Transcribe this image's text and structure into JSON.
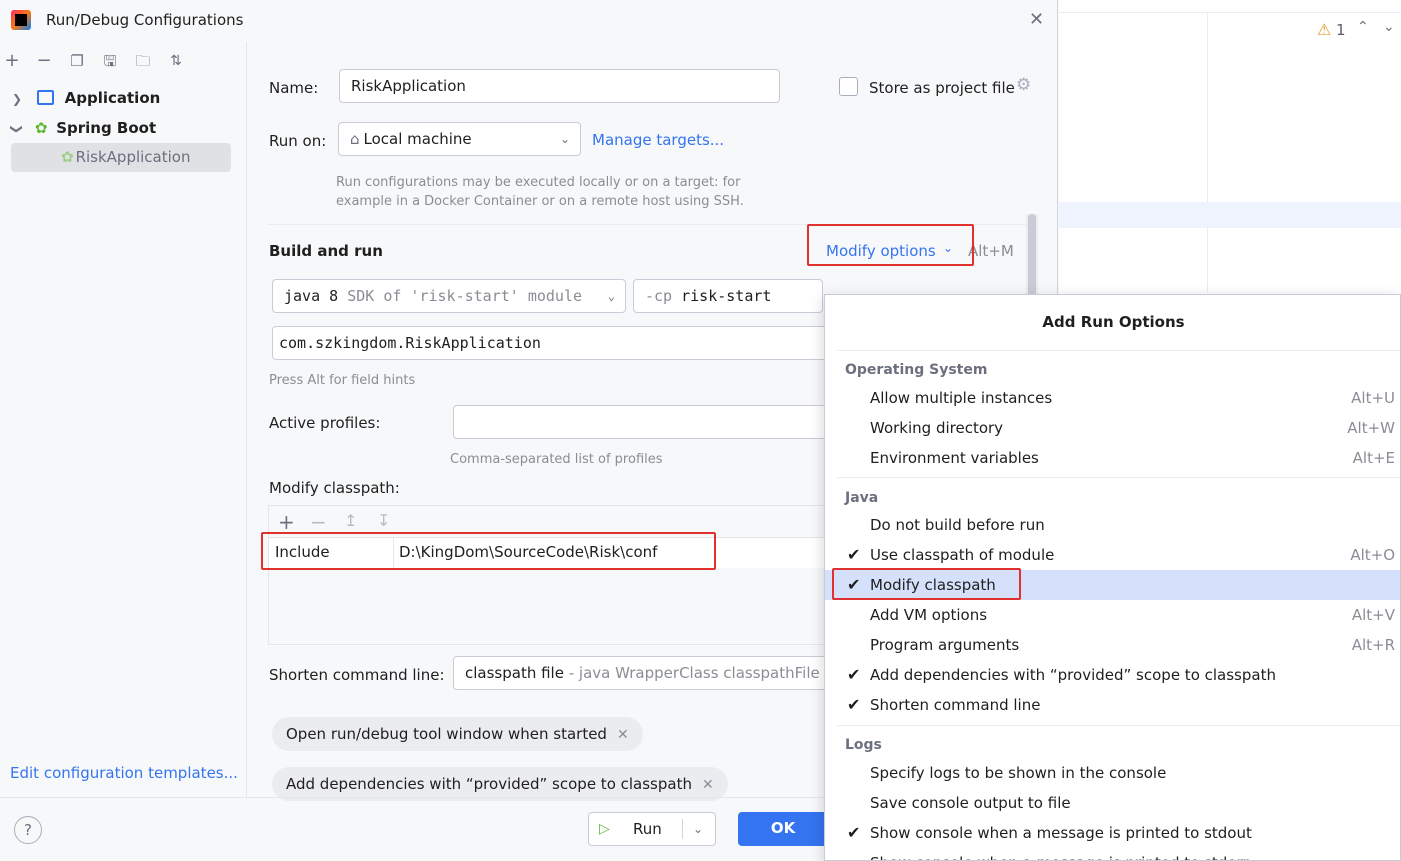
{
  "window": {
    "title": "Run/Debug Configurations"
  },
  "toolbar": {
    "icons": [
      "add-icon",
      "remove-icon",
      "copy-icon",
      "save-icon",
      "new-folder-icon",
      "sort-icon"
    ]
  },
  "tree": {
    "items": [
      {
        "label": "Application",
        "icon": "application-icon",
        "expanded": false
      },
      {
        "label": "Spring Boot",
        "icon": "spring-boot-icon",
        "expanded": true
      },
      {
        "label": "RiskApplication",
        "icon": "spring-boot-icon",
        "selected": true
      }
    ]
  },
  "left_footer": {
    "edit_templates": "Edit configuration templates..."
  },
  "form": {
    "name_label": "Name:",
    "name_value": "RiskApplication",
    "store_label": "Store as project file",
    "run_on_label": "Run on:",
    "run_on_value": "Local machine",
    "manage_targets": "Manage targets...",
    "run_on_hint_1": "Run configurations may be executed locally or on a target: for",
    "run_on_hint_2": "example in a Docker Container or on a remote host using SSH.",
    "build_run_title": "Build and run",
    "modify_options": "Modify options",
    "modify_options_shortcut": "Alt+M",
    "jdk_java": "java 8",
    "jdk_desc": "SDK of 'risk-start' module",
    "cp_flag": "-cp",
    "cp_value": "risk-start",
    "main_class": "com.szkingdom.RiskApplication",
    "field_hint": "Press Alt for field hints",
    "active_profiles_label": "Active profiles:",
    "active_profiles_value": "",
    "profiles_hint": "Comma-separated list of profiles",
    "modify_classpath_label": "Modify classpath:",
    "classpath_rows": [
      {
        "type": "Include",
        "path": "D:\\KingDom\\SourceCode\\Risk\\conf"
      }
    ],
    "shorten_label": "Shorten command line:",
    "shorten_value": "classpath file",
    "shorten_desc": "- java WrapperClass classpathFile cla",
    "chips": [
      "Open run/debug tool window when started",
      "Add dependencies with “provided” scope to classpath"
    ]
  },
  "footer": {
    "run_label": "Run",
    "ok_label": "OK",
    "help_label": "?"
  },
  "editor": {
    "warning_count": "1"
  },
  "popup": {
    "title": "Add Run Options",
    "sections": [
      {
        "name": "Operating System",
        "items": [
          {
            "label": "Allow multiple instances",
            "shortcut": "Alt+U",
            "checked": false
          },
          {
            "label": "Working directory",
            "shortcut": "Alt+W",
            "checked": false
          },
          {
            "label": "Environment variables",
            "shortcut": "Alt+E",
            "checked": false
          }
        ]
      },
      {
        "name": "Java",
        "items": [
          {
            "label": "Do not build before run",
            "shortcut": "",
            "checked": false
          },
          {
            "label": "Use classpath of module",
            "shortcut": "Alt+O",
            "checked": true
          },
          {
            "label": "Modify classpath",
            "shortcut": "",
            "checked": true,
            "highlighted": true
          },
          {
            "label": "Add VM options",
            "shortcut": "Alt+V",
            "checked": false
          },
          {
            "label": "Program arguments",
            "shortcut": "Alt+R",
            "checked": false
          },
          {
            "label": "Add dependencies with “provided” scope to classpath",
            "shortcut": "",
            "checked": true
          },
          {
            "label": "Shorten command line",
            "shortcut": "",
            "checked": true
          }
        ]
      },
      {
        "name": "Logs",
        "items": [
          {
            "label": "Specify logs to be shown in the console",
            "shortcut": "",
            "checked": false
          },
          {
            "label": "Save console output to file",
            "shortcut": "",
            "checked": false
          },
          {
            "label": "Show console when a message is printed to stdout",
            "shortcut": "",
            "checked": true
          },
          {
            "label": "Show console when a message is printed to stderr",
            "shortcut": "",
            "checked": false
          }
        ]
      }
    ]
  },
  "colors": {
    "accent": "#3574f0",
    "highlight_box": "#e0312f",
    "selection": "#d5e1fb"
  }
}
